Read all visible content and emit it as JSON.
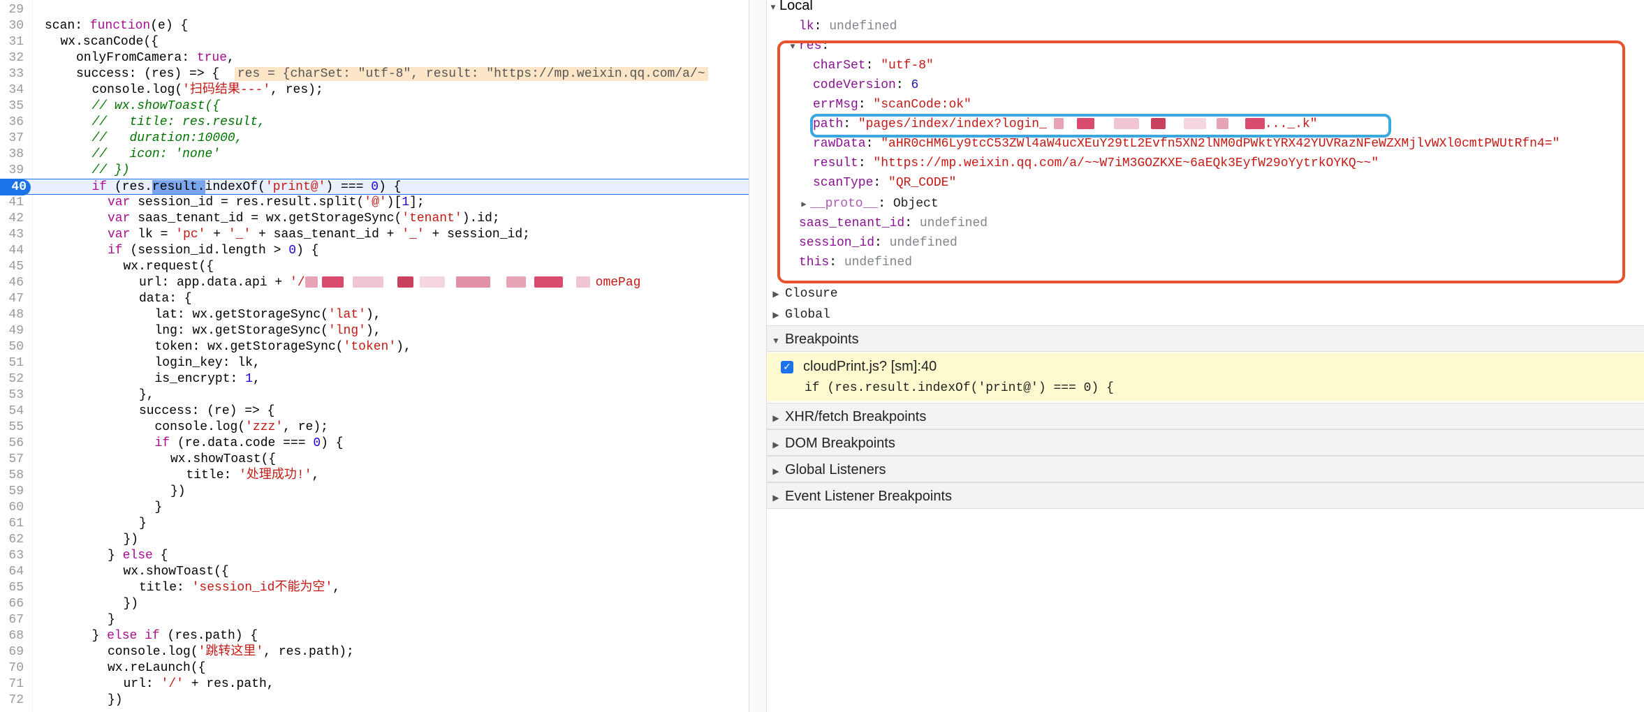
{
  "editor": {
    "lines": [
      {
        "n": "29",
        "parts": []
      },
      {
        "n": "30",
        "parts": [
          {
            "t": "scan: "
          },
          {
            "t": "function",
            "c": "kw"
          },
          {
            "t": "(e) {"
          }
        ],
        "indent": 0
      },
      {
        "n": "31",
        "parts": [
          {
            "t": "wx.scanCode({"
          }
        ],
        "indent": 1
      },
      {
        "n": "32",
        "parts": [
          {
            "t": "onlyFromCamera: "
          },
          {
            "t": "true",
            "c": "kw"
          },
          {
            "t": ","
          }
        ],
        "indent": 2
      },
      {
        "n": "33",
        "parts": [
          {
            "t": "success: (res) => {  "
          },
          {
            "t": "res = {charSet: \"utf-8\", result: \"https://mp.weixin.qq.com/a/~",
            "c": "inline"
          }
        ],
        "indent": 2
      },
      {
        "n": "34",
        "parts": [
          {
            "t": "console.log("
          },
          {
            "t": "'扫码结果---'",
            "c": "str"
          },
          {
            "t": ", res);"
          }
        ],
        "indent": 3
      },
      {
        "n": "35",
        "parts": [
          {
            "t": "// wx.showToast({",
            "c": "com"
          }
        ],
        "indent": 3
      },
      {
        "n": "36",
        "parts": [
          {
            "t": "//   title: res.result,",
            "c": "com"
          }
        ],
        "indent": 3
      },
      {
        "n": "37",
        "parts": [
          {
            "t": "//   duration:10000,",
            "c": "com"
          }
        ],
        "indent": 3
      },
      {
        "n": "38",
        "parts": [
          {
            "t": "//   icon: 'none'",
            "c": "com"
          }
        ],
        "indent": 3
      },
      {
        "n": "39",
        "parts": [
          {
            "t": "// })",
            "c": "com"
          }
        ],
        "indent": 3
      },
      {
        "n": "40",
        "parts": [
          {
            "t": "if",
            "c": "kw"
          },
          {
            "t": " (res."
          },
          {
            "t": "result.",
            "c": "hl"
          },
          {
            "t": "indexOf("
          },
          {
            "t": "'print@'",
            "c": "str"
          },
          {
            "t": ") === "
          },
          {
            "t": "0",
            "c": "num"
          },
          {
            "t": ") {"
          }
        ],
        "indent": 3,
        "current": true
      },
      {
        "n": "41",
        "parts": [
          {
            "t": "var",
            "c": "kw"
          },
          {
            "t": " session_id = res.result.split("
          },
          {
            "t": "'@'",
            "c": "str"
          },
          {
            "t": ")["
          },
          {
            "t": "1",
            "c": "num"
          },
          {
            "t": "];"
          }
        ],
        "indent": 4
      },
      {
        "n": "42",
        "parts": [
          {
            "t": "var",
            "c": "kw"
          },
          {
            "t": " saas_tenant_id = wx.getStorageSync("
          },
          {
            "t": "'tenant'",
            "c": "str"
          },
          {
            "t": ").id;"
          }
        ],
        "indent": 4
      },
      {
        "n": "43",
        "parts": [
          {
            "t": "var",
            "c": "kw"
          },
          {
            "t": " lk = "
          },
          {
            "t": "'pc'",
            "c": "str"
          },
          {
            "t": " + "
          },
          {
            "t": "'_'",
            "c": "str"
          },
          {
            "t": " + saas_tenant_id + "
          },
          {
            "t": "'_'",
            "c": "str"
          },
          {
            "t": " + session_id;"
          }
        ],
        "indent": 4
      },
      {
        "n": "44",
        "parts": [
          {
            "t": "if",
            "c": "kw"
          },
          {
            "t": " (session_id.length > "
          },
          {
            "t": "0",
            "c": "num"
          },
          {
            "t": ") {"
          }
        ],
        "indent": 4
      },
      {
        "n": "45",
        "parts": [
          {
            "t": "wx.request({"
          }
        ],
        "indent": 5
      },
      {
        "n": "46",
        "parts": [
          {
            "t": "url: app.data.api + "
          },
          {
            "t": "'/",
            "c": "str"
          },
          {
            "t": "",
            "c": "blur"
          },
          {
            "t": "omePag",
            "c": "str"
          }
        ],
        "indent": 6
      },
      {
        "n": "47",
        "parts": [
          {
            "t": "data: {"
          }
        ],
        "indent": 6
      },
      {
        "n": "48",
        "parts": [
          {
            "t": "lat: wx.getStorageSync("
          },
          {
            "t": "'lat'",
            "c": "str"
          },
          {
            "t": "),"
          }
        ],
        "indent": 7
      },
      {
        "n": "49",
        "parts": [
          {
            "t": "lng: wx.getStorageSync("
          },
          {
            "t": "'lng'",
            "c": "str"
          },
          {
            "t": "),"
          }
        ],
        "indent": 7
      },
      {
        "n": "50",
        "parts": [
          {
            "t": "token: wx.getStorageSync("
          },
          {
            "t": "'token'",
            "c": "str"
          },
          {
            "t": "),"
          }
        ],
        "indent": 7
      },
      {
        "n": "51",
        "parts": [
          {
            "t": "login_key: lk,"
          }
        ],
        "indent": 7
      },
      {
        "n": "52",
        "parts": [
          {
            "t": "is_encrypt: "
          },
          {
            "t": "1",
            "c": "num"
          },
          {
            "t": ","
          }
        ],
        "indent": 7
      },
      {
        "n": "53",
        "parts": [
          {
            "t": "},"
          }
        ],
        "indent": 6
      },
      {
        "n": "54",
        "parts": [
          {
            "t": "success: (re) => {"
          }
        ],
        "indent": 6
      },
      {
        "n": "55",
        "parts": [
          {
            "t": "console.log("
          },
          {
            "t": "'zzz'",
            "c": "str"
          },
          {
            "t": ", re);"
          }
        ],
        "indent": 7
      },
      {
        "n": "56",
        "parts": [
          {
            "t": "if",
            "c": "kw"
          },
          {
            "t": " (re.data.code === "
          },
          {
            "t": "0",
            "c": "num"
          },
          {
            "t": ") {"
          }
        ],
        "indent": 7
      },
      {
        "n": "57",
        "parts": [
          {
            "t": "wx.showToast({"
          }
        ],
        "indent": 8
      },
      {
        "n": "58",
        "parts": [
          {
            "t": "title: "
          },
          {
            "t": "'处理成功!'",
            "c": "str"
          },
          {
            "t": ","
          }
        ],
        "indent": 9
      },
      {
        "n": "59",
        "parts": [
          {
            "t": "})"
          }
        ],
        "indent": 8
      },
      {
        "n": "60",
        "parts": [
          {
            "t": "}"
          }
        ],
        "indent": 7
      },
      {
        "n": "61",
        "parts": [
          {
            "t": "}"
          }
        ],
        "indent": 6
      },
      {
        "n": "62",
        "parts": [
          {
            "t": "})"
          }
        ],
        "indent": 5
      },
      {
        "n": "63",
        "parts": [
          {
            "t": "} "
          },
          {
            "t": "else",
            "c": "kw"
          },
          {
            "t": " {"
          }
        ],
        "indent": 4
      },
      {
        "n": "64",
        "parts": [
          {
            "t": "wx.showToast({"
          }
        ],
        "indent": 5
      },
      {
        "n": "65",
        "parts": [
          {
            "t": "title: "
          },
          {
            "t": "'session_id不能为空'",
            "c": "str"
          },
          {
            "t": ","
          }
        ],
        "indent": 6
      },
      {
        "n": "66",
        "parts": [
          {
            "t": "})"
          }
        ],
        "indent": 5
      },
      {
        "n": "67",
        "parts": [
          {
            "t": "}"
          }
        ],
        "indent": 4
      },
      {
        "n": "68",
        "parts": [
          {
            "t": "} "
          },
          {
            "t": "else if",
            "c": "kw"
          },
          {
            "t": " (res.path) {"
          }
        ],
        "indent": 3
      },
      {
        "n": "69",
        "parts": [
          {
            "t": "console.log("
          },
          {
            "t": "'跳转这里'",
            "c": "str"
          },
          {
            "t": ", res.path);"
          }
        ],
        "indent": 4
      },
      {
        "n": "70",
        "parts": [
          {
            "t": "wx.reLaunch({"
          }
        ],
        "indent": 4
      },
      {
        "n": "71",
        "parts": [
          {
            "t": "url: "
          },
          {
            "t": "'/'",
            "c": "str"
          },
          {
            "t": " + res.path,"
          }
        ],
        "indent": 5
      },
      {
        "n": "72",
        "parts": [
          {
            "t": "})"
          }
        ],
        "indent": 4
      }
    ]
  },
  "scope": {
    "local_header": "Local",
    "lk": {
      "key": "lk",
      "value": "undefined"
    },
    "res_key": "res",
    "res_props": [
      {
        "key": "charSet",
        "value": "\"utf-8\"",
        "type": "str"
      },
      {
        "key": "codeVersion",
        "value": "6",
        "type": "num"
      },
      {
        "key": "errMsg",
        "value": "\"scanCode:ok\"",
        "type": "str"
      },
      {
        "key": "path",
        "value": "\"pages/index/index?login_",
        "tail": "..._.k\"",
        "type": "str",
        "blur": true
      },
      {
        "key": "rawData",
        "value": "\"aHR0cHM6Ly9tcC53ZWl4aW4ucXEuY29tL2Evfn5XN2lNM0dPWktYRX42YUVRazNFeWZXMjlvWXl0cmtPWUtRfn4=\"",
        "type": "str"
      },
      {
        "key": "result",
        "value": "\"https://mp.weixin.qq.com/a/~~W7iM3GOZKXE~6aEQk3EyfW29oYytrkOYKQ~~\"",
        "type": "str"
      },
      {
        "key": "scanType",
        "value": "\"QR_CODE\"",
        "type": "str"
      }
    ],
    "proto": {
      "key": "__proto__",
      "value": "Object"
    },
    "others": [
      {
        "key": "saas_tenant_id",
        "value": "undefined"
      },
      {
        "key": "session_id",
        "value": "undefined"
      },
      {
        "key": "this",
        "value": "undefined"
      }
    ],
    "closure": "Closure",
    "global": "Global"
  },
  "breakpoints": {
    "header": "Breakpoints",
    "item_name": "cloudPrint.js? [sm]:40",
    "item_code": "if (res.result.indexOf('print@') === 0) {"
  },
  "sections": [
    "XHR/fetch Breakpoints",
    "DOM Breakpoints",
    "Global Listeners",
    "Event Listener Breakpoints"
  ],
  "colors": {
    "annotation_red": "#e8522f",
    "annotation_blue": "#3aa7e0",
    "current_line": "#1a73e8",
    "breakpoint_bg": "#fffbd0"
  }
}
